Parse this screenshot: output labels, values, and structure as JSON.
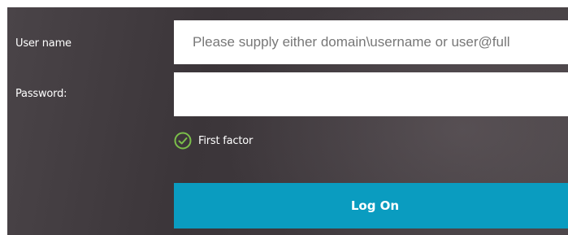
{
  "form": {
    "username_label": "User name",
    "username_placeholder": "Please supply either domain\\username or user@full",
    "username_value": "",
    "password_label": "Password:",
    "password_value": ""
  },
  "factor": {
    "icon": "check-circle-icon",
    "label": "First factor",
    "color": "#7bbf4a"
  },
  "actions": {
    "logon_label": "Log On",
    "logon_color": "#0a9cc0"
  }
}
